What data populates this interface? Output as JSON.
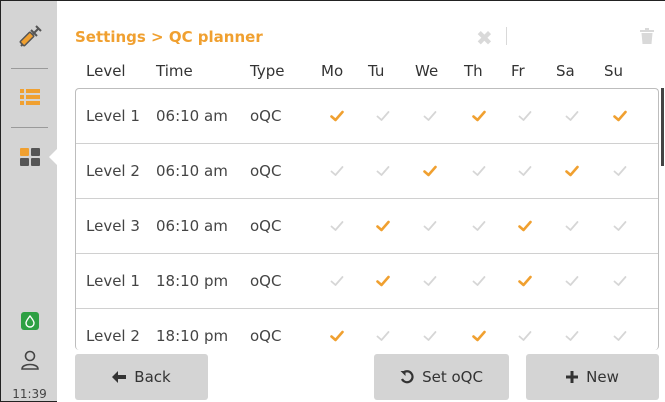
{
  "breadcrumb": "Settings > QC planner",
  "sidebar": {
    "time": "11:39",
    "items": [
      {
        "icon": "syringe-icon"
      },
      {
        "icon": "list-icon"
      },
      {
        "icon": "grid-icon",
        "active": true
      },
      {
        "icon": "droplet-icon"
      },
      {
        "icon": "user-icon"
      }
    ]
  },
  "table": {
    "headers": {
      "level": "Level",
      "time": "Time",
      "type": "Type",
      "mo": "Mo",
      "tu": "Tu",
      "we": "We",
      "th": "Th",
      "fr": "Fr",
      "sa": "Sa",
      "su": "Su"
    },
    "rows": [
      {
        "level": "Level 1",
        "time": "06:10 am",
        "type": "oQC",
        "days": [
          true,
          false,
          false,
          true,
          false,
          false,
          true
        ]
      },
      {
        "level": "Level 2",
        "time": "06:10 am",
        "type": "oQC",
        "days": [
          false,
          false,
          true,
          false,
          false,
          true,
          false
        ]
      },
      {
        "level": "Level 3",
        "time": "06:10 am",
        "type": "oQC",
        "days": [
          false,
          true,
          false,
          false,
          true,
          false,
          false
        ]
      },
      {
        "level": "Level 1",
        "time": "18:10 pm",
        "type": "oQC",
        "days": [
          false,
          true,
          false,
          false,
          true,
          false,
          false
        ]
      },
      {
        "level": "Level 2",
        "time": "18:10 pm",
        "type": "oQC",
        "days": [
          true,
          false,
          false,
          true,
          false,
          false,
          false
        ]
      }
    ]
  },
  "buttons": {
    "back": "Back",
    "set_oqc": "Set oQC",
    "new": "New"
  },
  "colors": {
    "accent": "#f0a030",
    "check_off": "#d6d6d6",
    "sidebar_bg": "#d4d4d4",
    "button_bg": "#d4d4d4"
  }
}
